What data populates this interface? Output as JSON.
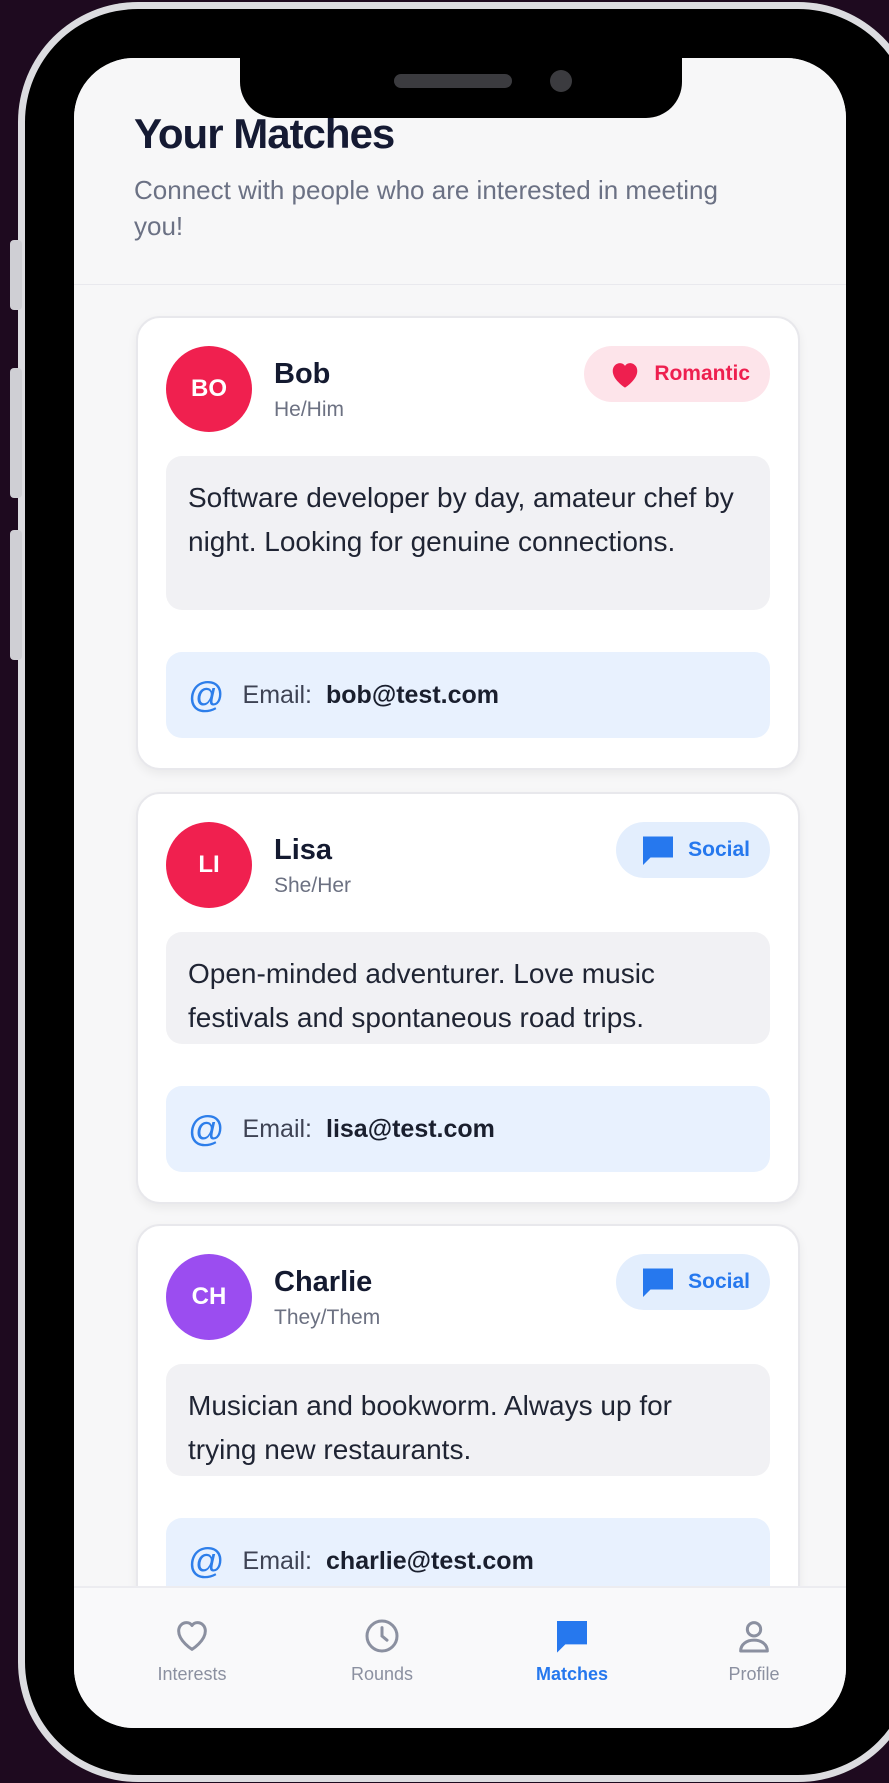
{
  "header": {
    "title": "Your Matches",
    "subtitle": "Connect with people who are interested in meeting you!"
  },
  "email_label": "Email:",
  "matches": [
    {
      "initials": "BO",
      "name": "Bob",
      "pronouns": "He/Him",
      "type": "Romantic",
      "type_icon": "heart-icon",
      "avatar_color": "#f0204f",
      "bio": "Software developer by day, amateur chef by night. Looking for genuine connections.",
      "email": "bob@test.com"
    },
    {
      "initials": "LI",
      "name": "Lisa",
      "pronouns": "She/Her",
      "type": "Social",
      "type_icon": "chat-bubble-icon",
      "avatar_color": "#f0204f",
      "bio": "Open-minded adventurer. Love music festivals and spontaneous road trips.",
      "email": "lisa@test.com"
    },
    {
      "initials": "CH",
      "name": "Charlie",
      "pronouns": "They/Them",
      "type": "Social",
      "type_icon": "chat-bubble-icon",
      "avatar_color": "#9b4df0",
      "bio": "Musician and bookworm. Always up for trying new restaurants.",
      "email": "charlie@test.com"
    }
  ],
  "tabs": [
    {
      "label": "Interests",
      "icon": "heart-outline-icon",
      "active": false
    },
    {
      "label": "Rounds",
      "icon": "clock-icon",
      "active": false
    },
    {
      "label": "Matches",
      "icon": "chat-bubble-icon",
      "active": true
    },
    {
      "label": "Profile",
      "icon": "user-icon",
      "active": false
    }
  ],
  "colors": {
    "romantic": "#ee1f4f",
    "social": "#2678ee",
    "title": "#151a33"
  }
}
